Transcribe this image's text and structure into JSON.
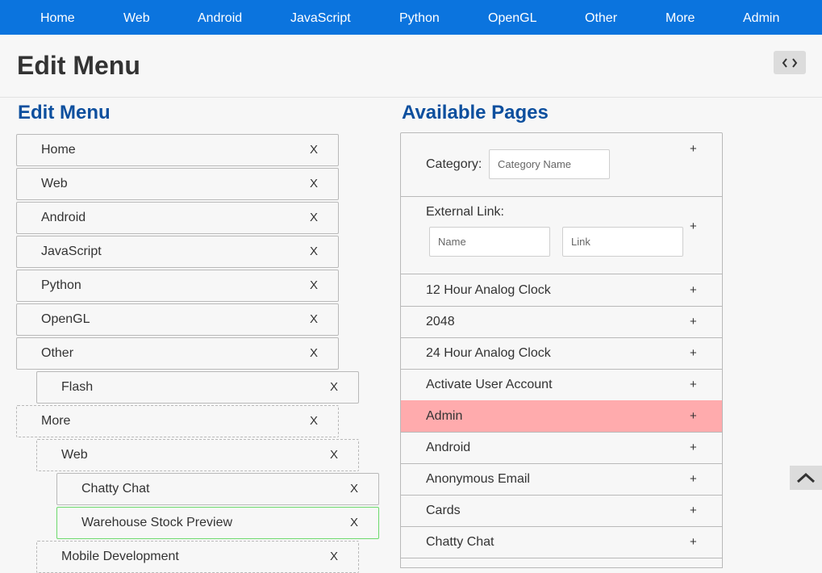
{
  "nav": {
    "items": [
      "Home",
      "Web",
      "Android",
      "JavaScript",
      "Python",
      "OpenGL",
      "Other",
      "More",
      "Admin"
    ]
  },
  "header": {
    "title": "Edit Menu",
    "code_icon": "code-brackets-icon"
  },
  "edit_menu": {
    "heading": "Edit Menu",
    "remove_label": "X",
    "items": [
      {
        "label": "Home",
        "level": 0,
        "border": "solid"
      },
      {
        "label": "Web",
        "level": 0,
        "border": "solid"
      },
      {
        "label": "Android",
        "level": 0,
        "border": "solid"
      },
      {
        "label": "JavaScript",
        "level": 0,
        "border": "solid"
      },
      {
        "label": "Python",
        "level": 0,
        "border": "solid"
      },
      {
        "label": "OpenGL",
        "level": 0,
        "border": "solid"
      },
      {
        "label": "Other",
        "level": 0,
        "border": "solid"
      },
      {
        "label": "Flash",
        "level": 1,
        "border": "solid"
      },
      {
        "label": "More",
        "level": 0,
        "border": "dashed"
      },
      {
        "label": "Web",
        "level": 1,
        "border": "dashed"
      },
      {
        "label": "Chatty Chat",
        "level": 2,
        "border": "solid"
      },
      {
        "label": "Warehouse Stock Preview",
        "level": 2,
        "border": "active"
      },
      {
        "label": "Mobile Development",
        "level": 1,
        "border": "dashed"
      }
    ]
  },
  "available_pages": {
    "heading": "Available Pages",
    "add_label": "+",
    "category": {
      "label": "Category:",
      "placeholder": "Category Name"
    },
    "external_link": {
      "label": "External Link:",
      "name_placeholder": "Name",
      "link_placeholder": "Link"
    },
    "pages": [
      {
        "label": "12 Hour Analog Clock",
        "highlight": false
      },
      {
        "label": "2048",
        "highlight": false
      },
      {
        "label": "24 Hour Analog Clock",
        "highlight": false
      },
      {
        "label": "Activate User Account",
        "highlight": false
      },
      {
        "label": "Admin",
        "highlight": true
      },
      {
        "label": "Android",
        "highlight": false
      },
      {
        "label": "Anonymous Email",
        "highlight": false
      },
      {
        "label": "Cards",
        "highlight": false
      },
      {
        "label": "Chatty Chat",
        "highlight": false
      }
    ]
  },
  "scroll_top_icon": "chevron-up-icon"
}
